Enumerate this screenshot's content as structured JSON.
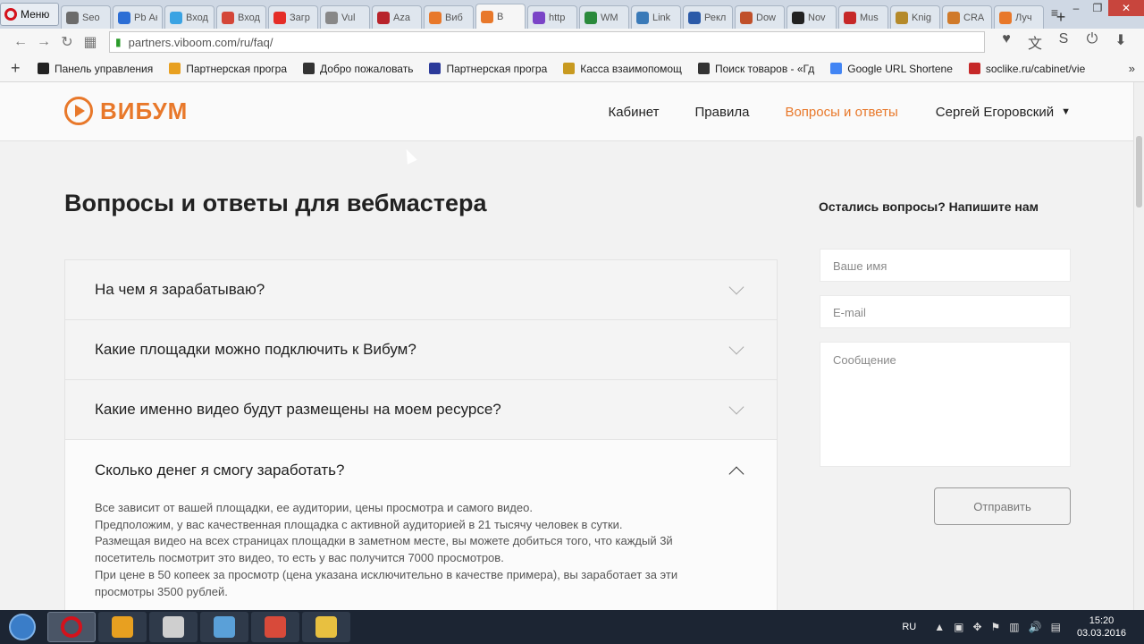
{
  "browser": {
    "menu_label": "Меню",
    "tabs": [
      {
        "label": "Seo",
        "color": "#6b6b6b"
      },
      {
        "label": "Pb Акк",
        "color": "#2c6ed5"
      },
      {
        "label": "Вход",
        "color": "#3aa3e3"
      },
      {
        "label": "Вход",
        "color": "#d44638"
      },
      {
        "label": "Загр",
        "color": "#e52d27"
      },
      {
        "label": "Vul",
        "color": "#888888"
      },
      {
        "label": "Aza",
        "color": "#b8232b"
      },
      {
        "label": "Виб",
        "color": "#e8782a"
      },
      {
        "label": "В",
        "color": "#e8782a",
        "active": true
      },
      {
        "label": "http",
        "color": "#7a44c7"
      },
      {
        "label": "WM",
        "color": "#2a8a3c"
      },
      {
        "label": "Link",
        "color": "#3a7ab8"
      },
      {
        "label": "Рекл",
        "color": "#2b5aa8"
      },
      {
        "label": "Dow",
        "color": "#c0502a"
      },
      {
        "label": "Nov",
        "color": "#222222"
      },
      {
        "label": "Mus",
        "color": "#c62828"
      },
      {
        "label": "Knig",
        "color": "#b58a2a"
      },
      {
        "label": "CRA",
        "color": "#d07a2a"
      },
      {
        "label": "Луч",
        "color": "#e8782a"
      }
    ],
    "url": "partners.viboom.com/ru/faq/",
    "bookmarks": [
      {
        "label": "Панель управления",
        "color": "#222222"
      },
      {
        "label": "Партнерская програ",
        "color": "#e8a020"
      },
      {
        "label": "Добро пожаловать",
        "color": "#333333"
      },
      {
        "label": "Партнерская програ",
        "color": "#2b3a9a"
      },
      {
        "label": "Касса взаимопомощ",
        "color": "#c89a20"
      },
      {
        "label": "Поиск товаров - «Гд",
        "color": "#333333"
      },
      {
        "label": "Google URL Shortene",
        "color": "#4285f4"
      },
      {
        "label": "soclike.ru/cabinet/vie",
        "color": "#c62828"
      }
    ]
  },
  "site": {
    "logo_text": "ВИБУМ",
    "nav": [
      {
        "label": "Кабинет",
        "active": false
      },
      {
        "label": "Правила",
        "active": false
      },
      {
        "label": "Вопросы и ответы",
        "active": true
      }
    ],
    "user_name": "Сергей Егоровский",
    "page_title": "Вопросы и ответы для вебмастера",
    "faq": [
      {
        "question": "На чем я зарабатываю?",
        "open": false
      },
      {
        "question": "Какие площадки можно подключить к Вибум?",
        "open": false
      },
      {
        "question": "Какие именно видео будут размещены на моем ресурсе?",
        "open": false
      },
      {
        "question": "Сколько денег я смогу заработать?",
        "open": true,
        "answer_lines": [
          "Все зависит от вашей площадки, ее аудитории, цены просмотра и самого видео.",
          "Предположим, у вас качественная площадка с активной аудиторией в 21 тысячу человек в сутки.",
          "Размещая видео на всех страницах площадки в заметном месте, вы можете добиться того, что каждый 3й",
          "посетитель посмотрит это видео, то есть у вас получится 7000 просмотров.",
          "При цене в 50 копеек за просмотр (цена указана исключительно в качестве примера), вы заработает за эти",
          "просмотры 3500 рублей."
        ]
      }
    ],
    "contact": {
      "title": "Остались вопросы? Напишите нам",
      "name_placeholder": "Ваше имя",
      "email_placeholder": "E-mail",
      "message_placeholder": "Сообщение",
      "submit_label": "Отправить"
    }
  },
  "taskbar": {
    "apps": [
      {
        "name": "opera",
        "color": "#d4121c",
        "active": true
      },
      {
        "name": "money",
        "color": "#e8a020",
        "active": false
      },
      {
        "name": "ghost",
        "color": "#cfcfcf",
        "active": false
      },
      {
        "name": "notes",
        "color": "#5aa0d8",
        "active": false
      },
      {
        "name": "paint",
        "color": "#d84a3a",
        "active": false
      },
      {
        "name": "folder",
        "color": "#e8c040",
        "active": false
      }
    ],
    "lang": "RU",
    "time": "15:20",
    "date": "03.03.2016"
  }
}
